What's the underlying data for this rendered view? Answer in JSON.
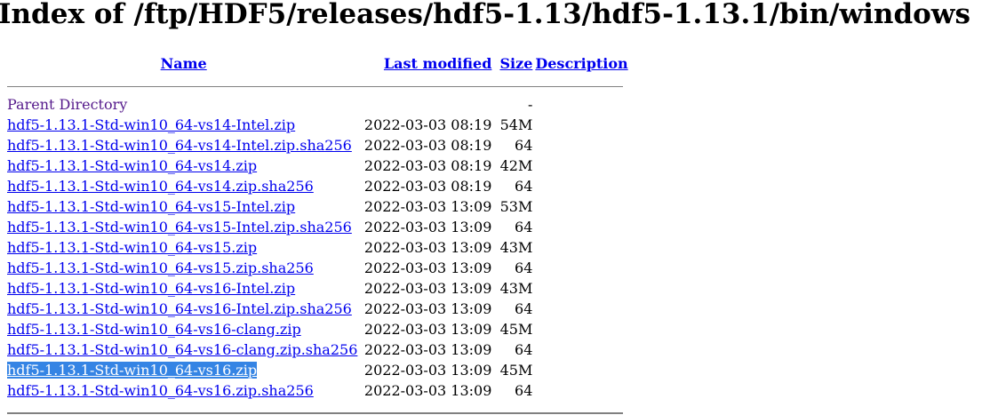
{
  "page": {
    "title": "Index of /ftp/HDF5/releases/hdf5-1.13/hdf5-1.13.1/bin/windows"
  },
  "columns": {
    "name": "Name",
    "last_modified": "Last modified",
    "size": "Size",
    "description": "Description"
  },
  "parent": {
    "label": "Parent Directory",
    "size": "-"
  },
  "files": [
    {
      "name": "hdf5-1.13.1-Std-win10_64-vs14-Intel.zip",
      "modified": "2022-03-03 08:19",
      "size": "54M",
      "selected": false
    },
    {
      "name": "hdf5-1.13.1-Std-win10_64-vs14-Intel.zip.sha256",
      "modified": "2022-03-03 08:19",
      "size": "64",
      "selected": false
    },
    {
      "name": "hdf5-1.13.1-Std-win10_64-vs14.zip",
      "modified": "2022-03-03 08:19",
      "size": "42M",
      "selected": false
    },
    {
      "name": "hdf5-1.13.1-Std-win10_64-vs14.zip.sha256",
      "modified": "2022-03-03 08:19",
      "size": "64",
      "selected": false
    },
    {
      "name": "hdf5-1.13.1-Std-win10_64-vs15-Intel.zip",
      "modified": "2022-03-03 13:09",
      "size": "53M",
      "selected": false
    },
    {
      "name": "hdf5-1.13.1-Std-win10_64-vs15-Intel.zip.sha256",
      "modified": "2022-03-03 13:09",
      "size": "64",
      "selected": false
    },
    {
      "name": "hdf5-1.13.1-Std-win10_64-vs15.zip",
      "modified": "2022-03-03 13:09",
      "size": "43M",
      "selected": false
    },
    {
      "name": "hdf5-1.13.1-Std-win10_64-vs15.zip.sha256",
      "modified": "2022-03-03 13:09",
      "size": "64",
      "selected": false
    },
    {
      "name": "hdf5-1.13.1-Std-win10_64-vs16-Intel.zip",
      "modified": "2022-03-03 13:09",
      "size": "43M",
      "selected": false
    },
    {
      "name": "hdf5-1.13.1-Std-win10_64-vs16-Intel.zip.sha256",
      "modified": "2022-03-03 13:09",
      "size": "64",
      "selected": false
    },
    {
      "name": "hdf5-1.13.1-Std-win10_64-vs16-clang.zip",
      "modified": "2022-03-03 13:09",
      "size": "45M",
      "selected": false
    },
    {
      "name": "hdf5-1.13.1-Std-win10_64-vs16-clang.zip.sha256",
      "modified": "2022-03-03 13:09",
      "size": "64",
      "selected": false
    },
    {
      "name": "hdf5-1.13.1-Std-win10_64-vs16.zip",
      "modified": "2022-03-03 13:09",
      "size": "45M",
      "selected": true
    },
    {
      "name": "hdf5-1.13.1-Std-win10_64-vs16.zip.sha256",
      "modified": "2022-03-03 13:09",
      "size": "64",
      "selected": false
    }
  ]
}
